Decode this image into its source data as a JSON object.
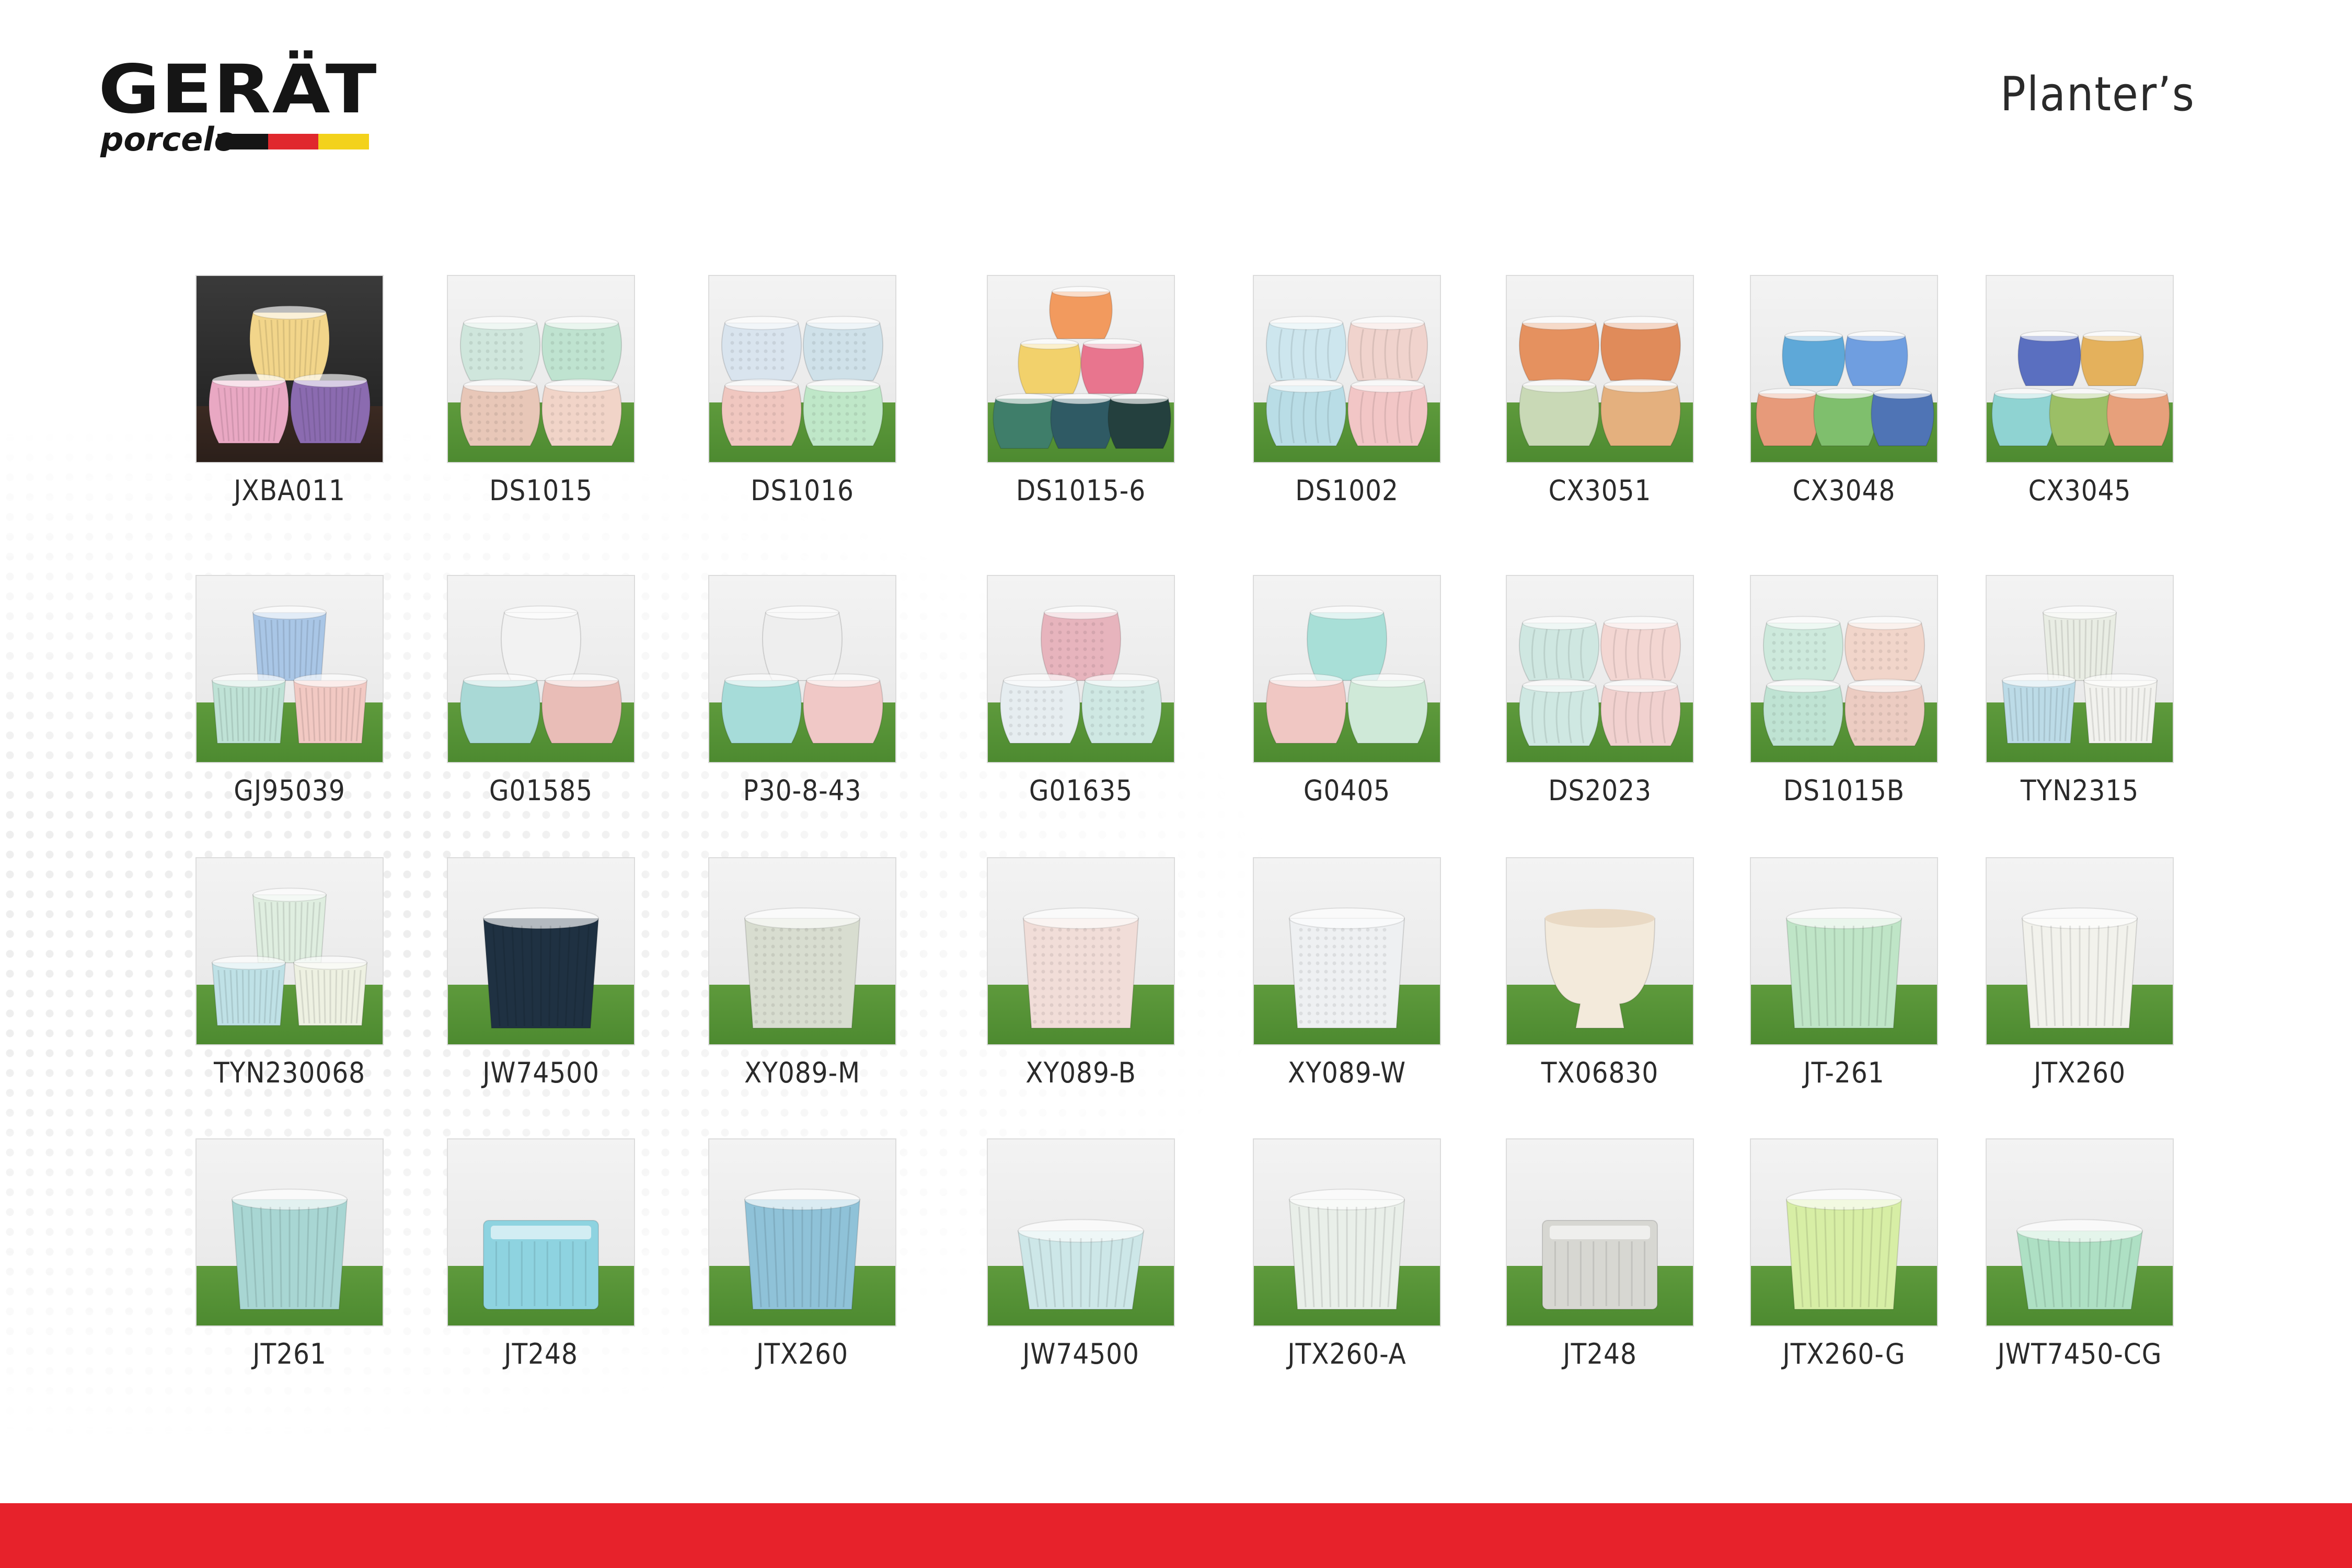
{
  "brand": {
    "name": "GERÄT",
    "sub": "porcelo"
  },
  "page_title": "Planter’s",
  "colors": {
    "accent_red": "#e7222b",
    "flag_black": "#151515",
    "flag_red": "#e0282d",
    "flag_yellow": "#f3d21b"
  },
  "rows": [
    {
      "items": [
        {
          "code": "JXBA011",
          "pots": [
            {
              "c": "#f2d58a",
              "s": "flute"
            },
            {
              "c": "#e9a8c3",
              "s": "flute"
            },
            {
              "c": "#8b6bb0",
              "s": "flute"
            }
          ],
          "dark": true
        },
        {
          "code": "DS1015",
          "pots": [
            {
              "c": "#cfe6dc",
              "s": "dot"
            },
            {
              "c": "#bfe3d0",
              "s": "dot"
            },
            {
              "c": "#e8c7b8",
              "s": "dot"
            },
            {
              "c": "#f1d4c8",
              "s": "dot"
            }
          ]
        },
        {
          "code": "DS1016",
          "pots": [
            {
              "c": "#d9e4ee",
              "s": "dot"
            },
            {
              "c": "#cfe1e9",
              "s": "dot"
            },
            {
              "c": "#f0c7c0",
              "s": "dot"
            },
            {
              "c": "#bfe7c8",
              "s": "dot"
            }
          ]
        },
        {
          "code": "DS1015-6",
          "pots": [
            {
              "c": "#f29a5e",
              "s": "round"
            },
            {
              "c": "#f2d16b",
              "s": "round"
            },
            {
              "c": "#e8758e",
              "s": "round"
            },
            {
              "c": "#3f7e6a",
              "s": "round"
            },
            {
              "c": "#2f5a64",
              "s": "round"
            },
            {
              "c": "#24403e",
              "s": "round"
            }
          ]
        },
        {
          "code": "DS1002",
          "pots": [
            {
              "c": "#cde6ee",
              "s": "wave"
            },
            {
              "c": "#f0d3cd",
              "s": "wave"
            },
            {
              "c": "#b9dde6",
              "s": "wave"
            },
            {
              "c": "#f2c6c6",
              "s": "wave"
            }
          ]
        },
        {
          "code": "CX3051",
          "pots": [
            {
              "c": "#e5915f",
              "s": "round"
            },
            {
              "c": "#e08b5a",
              "s": "round"
            },
            {
              "c": "#c9d9b6",
              "s": "round"
            },
            {
              "c": "#e4b07e",
              "s": "round"
            }
          ]
        },
        {
          "code": "CX3048",
          "pots": [
            {
              "c": "#5ea8d8",
              "s": "round"
            },
            {
              "c": "#6f9ee0",
              "s": "round"
            },
            {
              "c": "#e79a7a",
              "s": "round"
            },
            {
              "c": "#7fbf6d",
              "s": "round"
            },
            {
              "c": "#4f74b5",
              "s": "round"
            }
          ]
        },
        {
          "code": "CX3045",
          "pots": [
            {
              "c": "#5a6fc0",
              "s": "round"
            },
            {
              "c": "#e4b15c",
              "s": "round"
            },
            {
              "c": "#8fd3d2",
              "s": "round"
            },
            {
              "c": "#9bbf66",
              "s": "round"
            },
            {
              "c": "#e7a07b",
              "s": "round"
            }
          ]
        }
      ]
    },
    {
      "items": [
        {
          "code": "GJ95039",
          "pots": [
            {
              "c": "#a9c6e6",
              "s": "tall"
            },
            {
              "c": "#bfe2d6",
              "s": "tall"
            },
            {
              "c": "#f2c9c3",
              "s": "tall"
            }
          ]
        },
        {
          "code": "G01585",
          "pots": [
            {
              "c": "#f2f2f2",
              "s": "round"
            },
            {
              "c": "#a9d9d6",
              "s": "round"
            },
            {
              "c": "#e9bdb7",
              "s": "round"
            }
          ]
        },
        {
          "code": "P30-8-43",
          "pots": [
            {
              "c": "#eeeeee",
              "s": "round"
            },
            {
              "c": "#a6dcd9",
              "s": "round"
            },
            {
              "c": "#f0c8c6",
              "s": "round"
            }
          ]
        },
        {
          "code": "G01635",
          "pots": [
            {
              "c": "#e7b4bd",
              "s": "dot"
            },
            {
              "c": "#e6edf0",
              "s": "dot"
            },
            {
              "c": "#cfe8e3",
              "s": "dot"
            }
          ]
        },
        {
          "code": "G0405",
          "pots": [
            {
              "c": "#a8dfd7",
              "s": "round"
            },
            {
              "c": "#f0c7c3",
              "s": "round"
            },
            {
              "c": "#cfe9d8",
              "s": "round"
            }
          ]
        },
        {
          "code": "DS2023",
          "pots": [
            {
              "c": "#cfe7e1",
              "s": "wave"
            },
            {
              "c": "#f3d6d2",
              "s": "wave"
            },
            {
              "c": "#cfe8e2",
              "s": "wave"
            },
            {
              "c": "#f1d1cf",
              "s": "wave"
            }
          ]
        },
        {
          "code": "DS1015B",
          "pots": [
            {
              "c": "#cde9dc",
              "s": "dot"
            },
            {
              "c": "#f1d5ca",
              "s": "dot"
            },
            {
              "c": "#bfe3d3",
              "s": "dot"
            },
            {
              "c": "#ecccc2",
              "s": "dot"
            }
          ]
        },
        {
          "code": "TYN2315",
          "pots": [
            {
              "c": "#e9ede4",
              "s": "tall"
            },
            {
              "c": "#bcdbe7",
              "s": "tall"
            },
            {
              "c": "#f2f2ee",
              "s": "tall"
            }
          ]
        }
      ]
    },
    {
      "items": [
        {
          "code": "TYN230068",
          "pots": [
            {
              "c": "#dfeee0",
              "s": "tall"
            },
            {
              "c": "#bfe1e6",
              "s": "tall"
            },
            {
              "c": "#eef1e2",
              "s": "tall"
            }
          ]
        },
        {
          "code": "JW74500",
          "pots": [
            {
              "c": "#1f3142",
              "s": "single"
            }
          ]
        },
        {
          "code": "XY089-M",
          "pots": [
            {
              "c": "#d8ddd0",
              "s": "singledot"
            }
          ]
        },
        {
          "code": "XY089-B",
          "pots": [
            {
              "c": "#f1ddd8",
              "s": "singledot"
            }
          ]
        },
        {
          "code": "XY089-W",
          "pots": [
            {
              "c": "#eef0f2",
              "s": "singledot"
            }
          ]
        },
        {
          "code": "TX06830",
          "pots": [
            {
              "c": "#f3eadb",
              "s": "head"
            }
          ]
        },
        {
          "code": "JT-261",
          "pots": [
            {
              "c": "#bfe5c7",
              "s": "single"
            }
          ]
        },
        {
          "code": "JTX260",
          "pots": [
            {
              "c": "#f2f2ec",
              "s": "single"
            }
          ]
        }
      ]
    },
    {
      "items": [
        {
          "code": "JT261",
          "pots": [
            {
              "c": "#a8d6d3",
              "s": "single"
            }
          ]
        },
        {
          "code": "JT248",
          "pots": [
            {
              "c": "#8ed3e0",
              "s": "square"
            }
          ]
        },
        {
          "code": "JTX260",
          "pots": [
            {
              "c": "#8fc2d8",
              "s": "single"
            }
          ]
        },
        {
          "code": "JW74500",
          "pots": [
            {
              "c": "#cde7e8",
              "s": "low"
            }
          ]
        },
        {
          "code": "JTX260-A",
          "pots": [
            {
              "c": "#e9efe9",
              "s": "single"
            }
          ]
        },
        {
          "code": "JT248",
          "pots": [
            {
              "c": "#d7d7d2",
              "s": "square"
            }
          ]
        },
        {
          "code": "JTX260-G",
          "pots": [
            {
              "c": "#d7eea5",
              "s": "single"
            }
          ]
        },
        {
          "code": "JWT7450-CG",
          "pots": [
            {
              "c": "#aee0c4",
              "s": "low"
            }
          ]
        }
      ]
    }
  ]
}
